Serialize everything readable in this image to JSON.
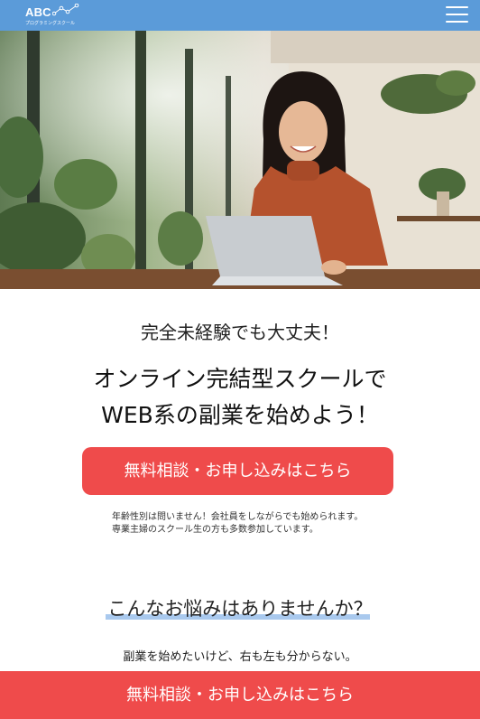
{
  "header": {
    "logo_text": "ABC",
    "logo_sub": "プログラミングスクール",
    "background": "#5b9bd9",
    "menu_icon": "hamburger-menu-icon"
  },
  "hero": {
    "image_alt": "",
    "palette": {
      "sweater": "#b5522d",
      "wall": "#e9e2d6"
    }
  },
  "catch": {
    "sub": "完全未経験でも大丈夫！",
    "line1": "オンライン完結型スクールで",
    "line2": "WEB系の副業を始めよう！"
  },
  "cta": {
    "label": "無料相談・お申し込みはこちら",
    "color": "#ef4b4b"
  },
  "note": {
    "line1": "年齢性別は問いません！会社員をしながらでも始められます。",
    "line2": "専業主婦のスクール生の方も多数参加しています。"
  },
  "worries": {
    "title": "こんなお悩みはありませんか？",
    "underline_color": "#a9c9ee",
    "items": [
      "副業を始めたいけど、右も左も分からない。"
    ]
  },
  "fixed_cta": {
    "label": "無料相談・お申し込みはこちら"
  }
}
